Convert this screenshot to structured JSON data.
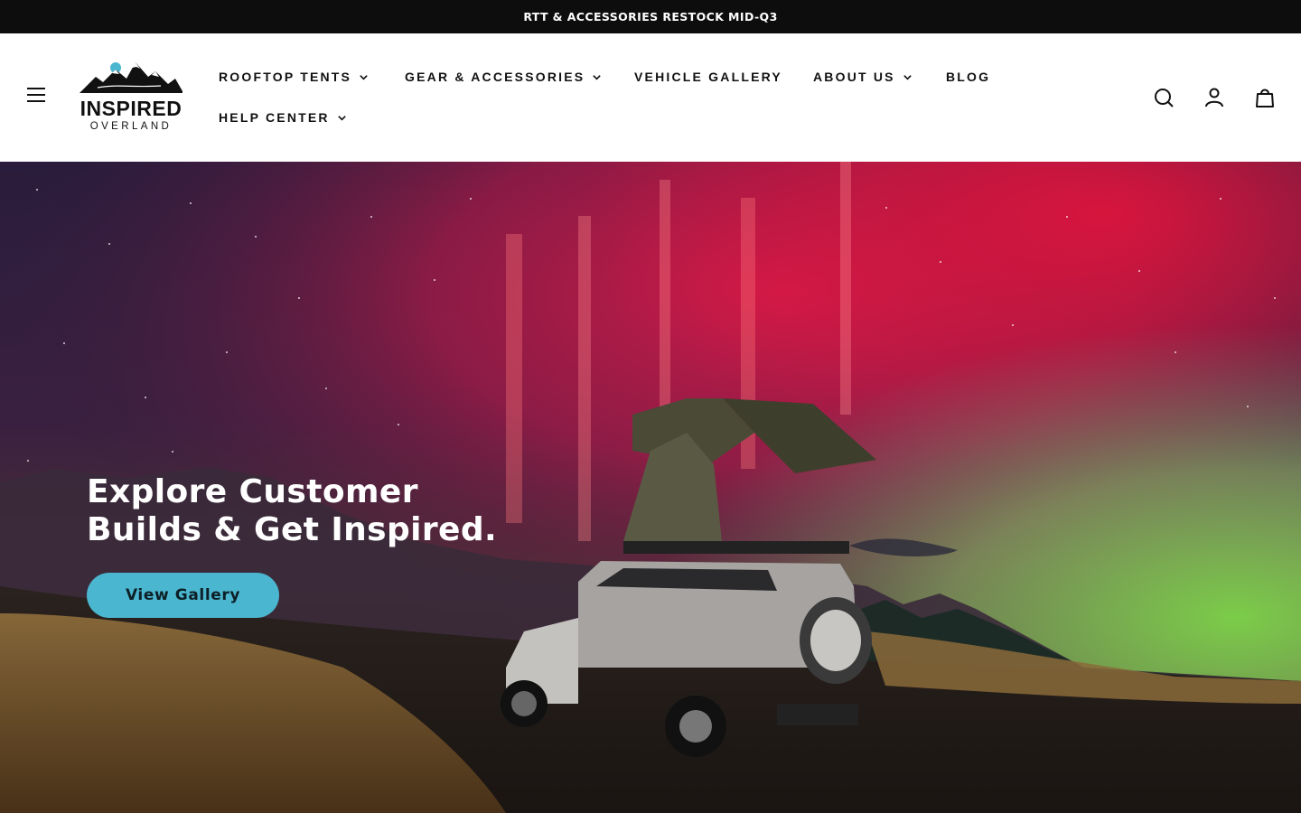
{
  "announcement": {
    "text": "RTT & ACCESSORIES RESTOCK MID-Q3"
  },
  "logo": {
    "name": "INSPIRED",
    "tagline": "OVERLAND"
  },
  "nav": {
    "items": [
      {
        "label": "ROOFTOP TENTS",
        "has_dropdown": true
      },
      {
        "label": "GEAR & ACCESSORIES",
        "has_dropdown": true
      },
      {
        "label": "VEHICLE GALLERY",
        "has_dropdown": false
      },
      {
        "label": "ABOUT US",
        "has_dropdown": true
      },
      {
        "label": "BLOG",
        "has_dropdown": false
      },
      {
        "label": "HELP CENTER",
        "has_dropdown": true
      }
    ]
  },
  "utility_icons": [
    "search-icon",
    "account-icon",
    "cart-icon"
  ],
  "hero": {
    "title_line1": "Explore Customer",
    "title_line2": "Builds & Get Inspired.",
    "button_label": "View Gallery"
  },
  "colors": {
    "announcement_bg": "#0d0d0d",
    "button_bg": "#4bb6cf",
    "text_dark": "#111111"
  }
}
